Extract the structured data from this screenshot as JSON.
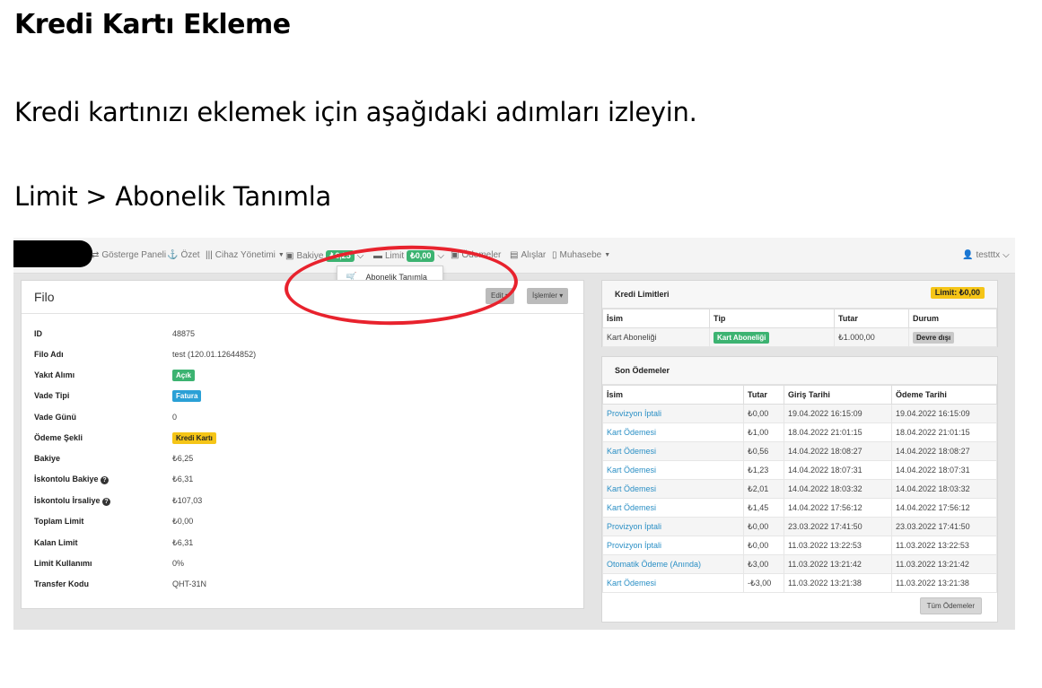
{
  "doc": {
    "title": "Kredi Kartı Ekleme",
    "intro": "Kredi kartınızı eklemek için aşağıdaki adımları izleyin.",
    "path": "Limit > Abonelik Tanımla"
  },
  "nav": {
    "items": {
      "gosterge": "Gösterge Paneli",
      "ozet": "Özet",
      "cihaz": "Cihaz Yönetimi",
      "bakiye": "Bakiye",
      "bakiye_value": "₺6,25",
      "limit": "Limit",
      "limit_value": "₺0,00",
      "odemeler": "Ödemeler",
      "alislar": "Alışlar",
      "muhasebe": "Muhasebe"
    },
    "user": "testttx",
    "dropdown_item": "Abonelik Tanımla"
  },
  "filo": {
    "title": "Filo",
    "edit_button": "Edit",
    "actions_button": "İşlemler",
    "rows": [
      {
        "label": "ID",
        "value": "48875"
      },
      {
        "label": "Filo Adı",
        "value": "test (120.01.12644852)"
      },
      {
        "label": "Yakıt Alımı",
        "value": "Açık"
      },
      {
        "label": "Vade Tipi",
        "value": "Fatura"
      },
      {
        "label": "Vade Günü",
        "value": "0"
      },
      {
        "label": "Ödeme Şekli",
        "value": "Kredi Kartı"
      },
      {
        "label": "Bakiye",
        "value": "₺6,25"
      },
      {
        "label": "İskontolu Bakiye",
        "value": "₺6,31"
      },
      {
        "label": "İskontolu İrsaliye",
        "value": "₺107,03"
      },
      {
        "label": "Toplam Limit",
        "value": "₺0,00"
      },
      {
        "label": "Kalan Limit",
        "value": "₺6,31"
      },
      {
        "label": "Limit Kullanımı",
        "value": "0%"
      },
      {
        "label": "Transfer Kodu",
        "value": "QHT-31N"
      }
    ]
  },
  "kredi": {
    "title": "Kredi Limitleri",
    "limit_badge": "Limit: ₺0,00",
    "headers": [
      "İsim",
      "Tip",
      "Tutar",
      "Durum"
    ],
    "row": {
      "isim": "Kart Aboneliği",
      "tip": "Kart Aboneliği",
      "tutar": "₺1.000,00",
      "durum": "Devre dışı"
    }
  },
  "son": {
    "title": "Son Ödemeler",
    "headers": [
      "İsim",
      "Tutar",
      "Giriş Tarihi",
      "Ödeme Tarihi"
    ],
    "rows": [
      {
        "isim": "Provizyon İptali",
        "tutar": "₺0,00",
        "giris": "19.04.2022 16:15:09",
        "odeme": "19.04.2022 16:15:09"
      },
      {
        "isim": "Kart Ödemesi",
        "tutar": "₺1,00",
        "giris": "18.04.2022 21:01:15",
        "odeme": "18.04.2022 21:01:15"
      },
      {
        "isim": "Kart Ödemesi",
        "tutar": "₺0,56",
        "giris": "14.04.2022 18:08:27",
        "odeme": "14.04.2022 18:08:27"
      },
      {
        "isim": "Kart Ödemesi",
        "tutar": "₺1,23",
        "giris": "14.04.2022 18:07:31",
        "odeme": "14.04.2022 18:07:31"
      },
      {
        "isim": "Kart Ödemesi",
        "tutar": "₺2,01",
        "giris": "14.04.2022 18:03:32",
        "odeme": "14.04.2022 18:03:32"
      },
      {
        "isim": "Kart Ödemesi",
        "tutar": "₺1,45",
        "giris": "14.04.2022 17:56:12",
        "odeme": "14.04.2022 17:56:12"
      },
      {
        "isim": "Provizyon İptali",
        "tutar": "₺0,00",
        "giris": "23.03.2022 17:41:50",
        "odeme": "23.03.2022 17:41:50"
      },
      {
        "isim": "Provizyon İptali",
        "tutar": "₺0,00",
        "giris": "11.03.2022 13:22:53",
        "odeme": "11.03.2022 13:22:53"
      },
      {
        "isim": "Otomatik Ödeme (Anında)",
        "tutar": "₺3,00",
        "giris": "11.03.2022 13:21:42",
        "odeme": "11.03.2022 13:21:42"
      },
      {
        "isim": "Kart Ödemesi",
        "tutar": "-₺3,00",
        "giris": "11.03.2022 13:21:38",
        "odeme": "11.03.2022 13:21:38"
      }
    ],
    "all_button": "Tüm Ödemeler"
  }
}
